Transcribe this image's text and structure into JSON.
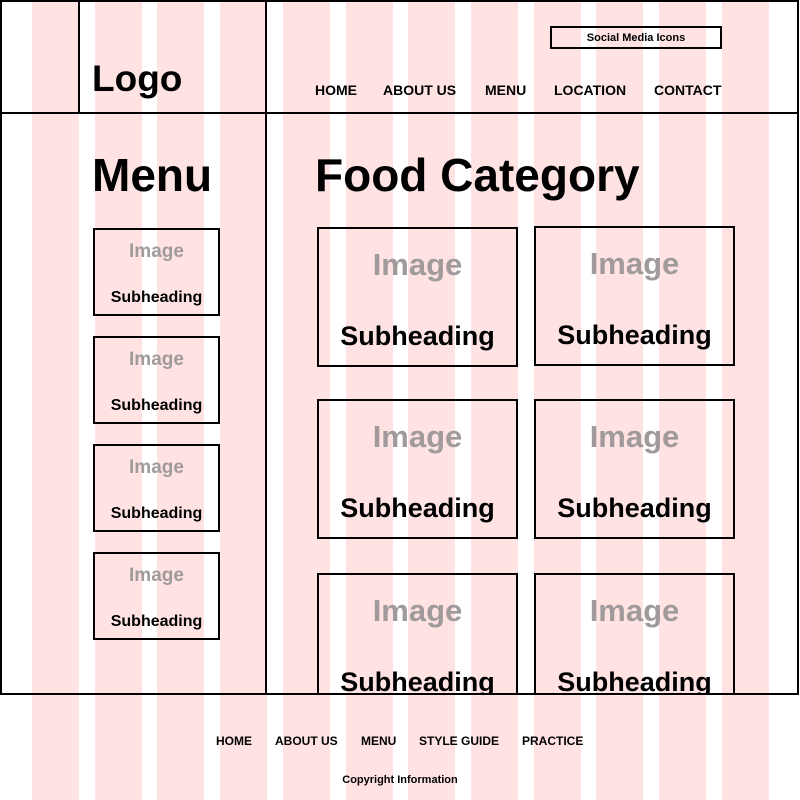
{
  "grid": {
    "columns": 12,
    "color": "#ffe3e3"
  },
  "header": {
    "logo": "Logo",
    "social": "Social Media Icons",
    "nav": [
      "HOME",
      "ABOUT US",
      "MENU",
      "LOCATION",
      "CONTACT"
    ]
  },
  "sidebar": {
    "title": "Menu",
    "cards": [
      {
        "image": "Image",
        "subheading": "Subheading"
      },
      {
        "image": "Image",
        "subheading": "Subheading"
      },
      {
        "image": "Image",
        "subheading": "Subheading"
      },
      {
        "image": "Image",
        "subheading": "Subheading"
      }
    ]
  },
  "main": {
    "title": "Food Category",
    "cards": [
      {
        "image": "Image",
        "subheading": "Subheading"
      },
      {
        "image": "Image",
        "subheading": "Subheading"
      },
      {
        "image": "Image",
        "subheading": "Subheading"
      },
      {
        "image": "Image",
        "subheading": "Subheading"
      },
      {
        "image": "Image",
        "subheading": "Subheading"
      },
      {
        "image": "Image",
        "subheading": "Subheading"
      }
    ]
  },
  "footer": {
    "nav": [
      "HOME",
      "ABOUT US",
      "MENU",
      "STYLE GUIDE",
      "PRACTICE"
    ],
    "copyright": "Copyright Information"
  }
}
